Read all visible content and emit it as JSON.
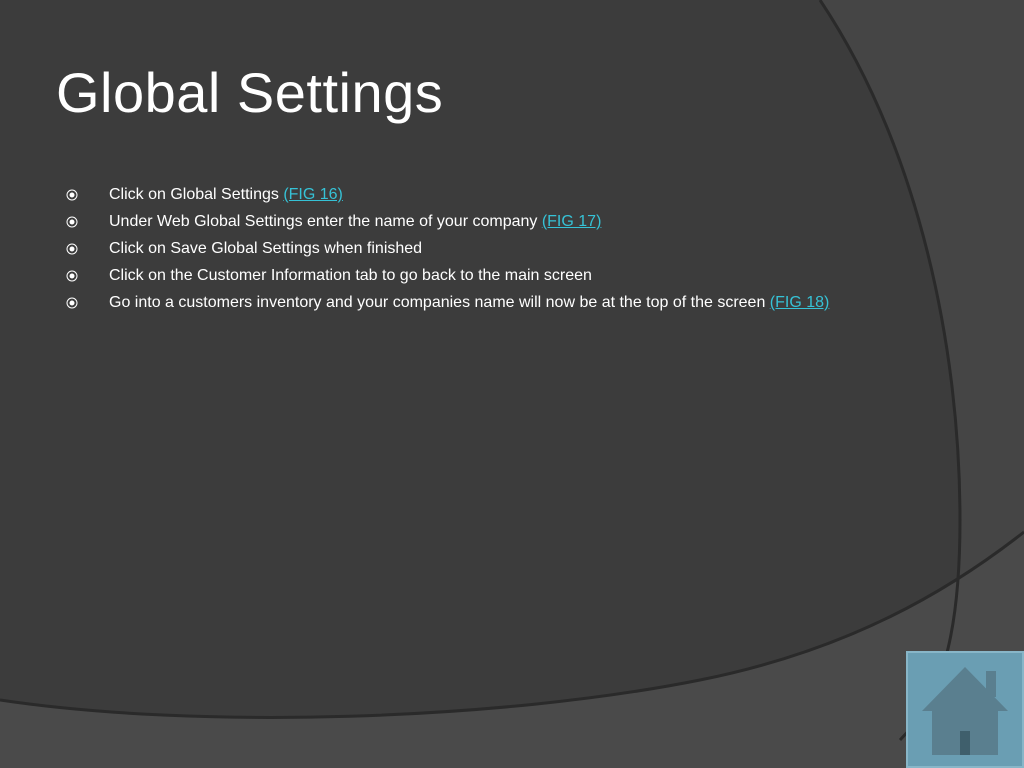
{
  "slide": {
    "title": "Global Settings",
    "items": [
      {
        "text": "Click on Global Settings ",
        "link": "(FIG 16)"
      },
      {
        "text": "Under Web Global Settings enter the name of your company ",
        "link": "(FIG 17)"
      },
      {
        "text": "Click on Save Global Settings when finished",
        "link": ""
      },
      {
        "text": "Click on the Customer Information tab to go back to the main screen",
        "link": ""
      },
      {
        "text": "Go into a customers inventory and your companies name will now be at the top of the screen ",
        "link": "(FIG 18)"
      }
    ]
  },
  "home_button": {
    "icon": "home-icon"
  },
  "colors": {
    "background": "#3b3b3b",
    "text": "#ffffff",
    "link": "#36c2d6",
    "home_button": "#6a9eb3"
  }
}
